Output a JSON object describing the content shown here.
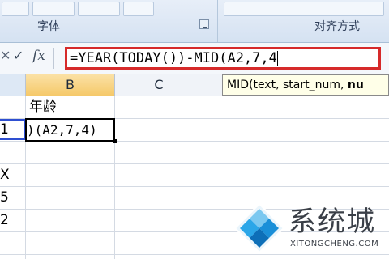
{
  "ribbon": {
    "font_group_label": "字体",
    "align_group_label": "对齐方式"
  },
  "formula_bar": {
    "cancel_icon": "✕",
    "enter_icon": "✓",
    "fx_label": "fx",
    "formula": "=YEAR(TODAY())-MID(A2,7,4"
  },
  "columns": [
    "B",
    "C"
  ],
  "tooltip": {
    "prefix": "MID(text, start_num, ",
    "bold": "nu"
  },
  "cells": {
    "b1": "年龄",
    "b2_edit": ")(A2,7,4)",
    "a2": "1",
    "a3": "X",
    "a4": "5",
    "a5": "2"
  },
  "watermark": {
    "brand": "系统城",
    "url": "XITONGCHENG.COM"
  },
  "colors": {
    "highlight_box": "#d62a2a",
    "reference_box": "#2e4fd1",
    "selected_column": "#f5c96a",
    "watermark_blue": "#1a8fd8"
  }
}
